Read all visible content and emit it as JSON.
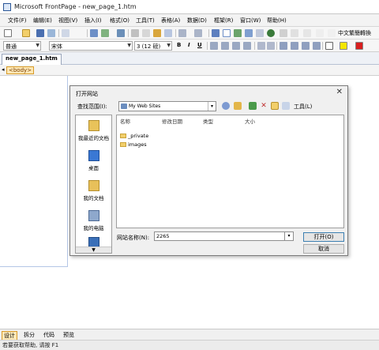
{
  "window": {
    "title": "Microsoft FrontPage - new_page_1.htm"
  },
  "menu": [
    "文件(F)",
    "编辑(E)",
    "视图(V)",
    "插入(I)",
    "格式(O)",
    "工具(T)",
    "表格(A)",
    "数据(D)",
    "框架(R)",
    "窗口(W)",
    "帮助(H)"
  ],
  "toolbar": {
    "ime_label": "中文繁簡轉換",
    "style_value": "普通",
    "font_value": "宋体",
    "size_value": "3 (12 磅)",
    "bold": "B",
    "italic": "I",
    "underline": "U",
    "highlight_color": "#f4e600",
    "font_color": "#d82020"
  },
  "document": {
    "tab_label": "new_page_1.htm",
    "tag_label": "<body>"
  },
  "dialog": {
    "title": "打开网站",
    "look_in_label": "查找范围(I):",
    "look_in_value": "My Web Sites",
    "tools_label": "工具(L)",
    "places": [
      "我最近的文档",
      "桌面",
      "我的文档",
      "我的电脑"
    ],
    "columns": [
      "名称",
      "修改日期",
      "类型",
      "大小"
    ],
    "files": [
      "_private",
      "images"
    ],
    "site_name_label": "网站名称(N):",
    "site_name_value": "2265",
    "open_button": "打开(O)",
    "cancel_button": "取消"
  },
  "views": [
    "设计",
    "拆分",
    "代码",
    "预览"
  ],
  "status": {
    "text": "若要获取帮助, 请按 F1"
  }
}
